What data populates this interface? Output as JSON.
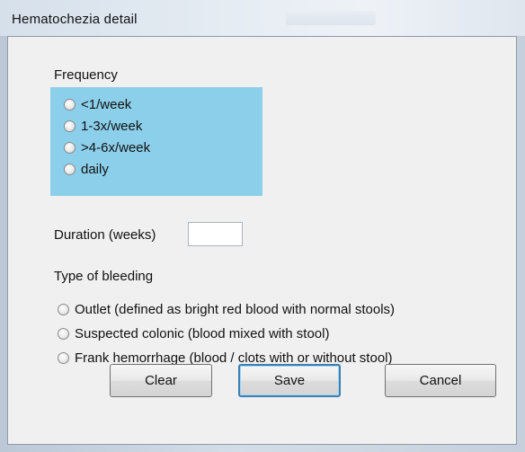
{
  "window": {
    "title": "Hematochezia detail"
  },
  "frequency": {
    "label": "Frequency",
    "options": [
      "<1/week",
      "1-3x/week",
      ">4-6x/week",
      "daily"
    ]
  },
  "duration": {
    "label": "Duration (weeks)",
    "value": ""
  },
  "bleeding": {
    "label": "Type of bleeding",
    "options": [
      "Outlet (defined as bright red blood with normal stools)",
      "Suspected colonic (blood mixed with stool)",
      "Frank hemorrhage (blood / clots with or without stool)"
    ]
  },
  "buttons": {
    "clear": "Clear",
    "save": "Save",
    "cancel": "Cancel"
  },
  "colors": {
    "frequency_highlight": "#8ccfea",
    "dialog_bg": "#f0f0f0"
  }
}
